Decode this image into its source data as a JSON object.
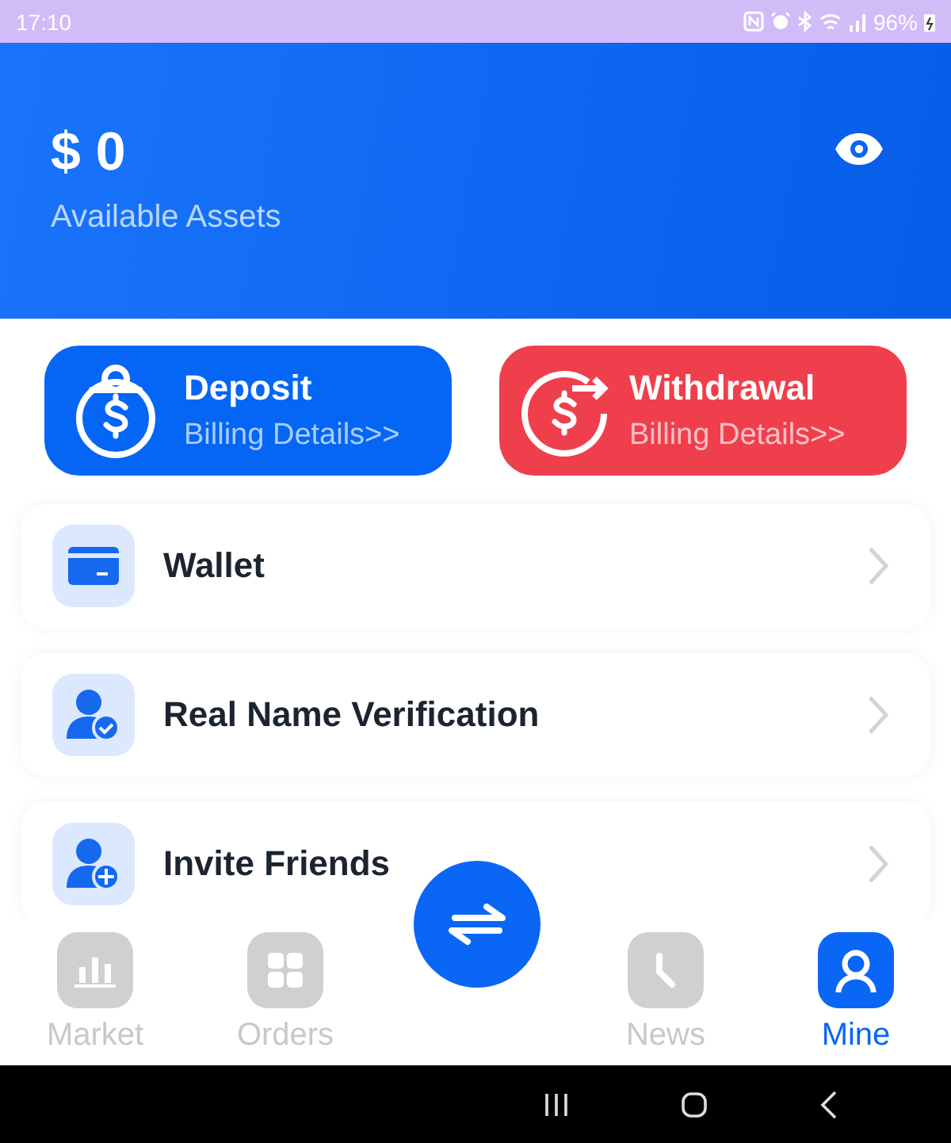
{
  "status_bar": {
    "time": "17:10",
    "battery": "96%"
  },
  "assets": {
    "amount": "$ 0",
    "label": "Available Assets"
  },
  "actions": [
    {
      "kind": "deposit",
      "title": "Deposit",
      "subtitle": "Billing Details>>"
    },
    {
      "kind": "withdrawal",
      "title": "Withdrawal",
      "subtitle": "Billing Details>>"
    }
  ],
  "menu": [
    {
      "kind": "wallet",
      "label": "Wallet"
    },
    {
      "kind": "verify",
      "label": "Real Name Verification"
    },
    {
      "kind": "invite",
      "label": "Invite Friends"
    }
  ],
  "tabs": [
    {
      "kind": "market",
      "label": "Market",
      "selected": false
    },
    {
      "kind": "orders",
      "label": "Orders",
      "selected": false
    },
    {
      "kind": "trade"
    },
    {
      "kind": "news",
      "label": "News",
      "selected": false
    },
    {
      "kind": "mine",
      "label": "Mine",
      "selected": true
    }
  ]
}
